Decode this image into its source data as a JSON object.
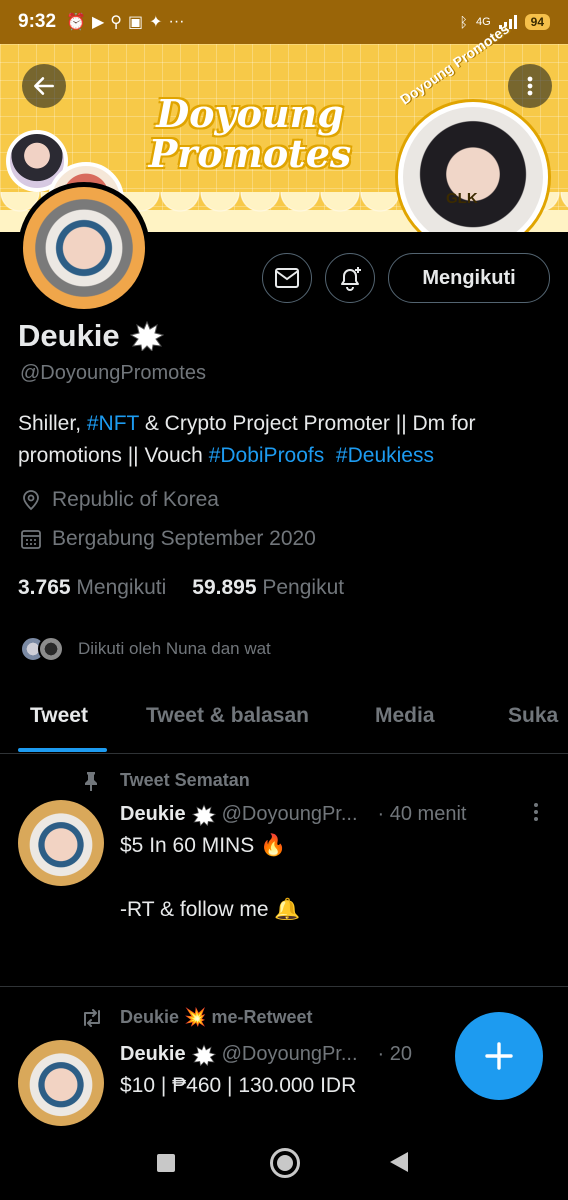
{
  "status_bar": {
    "time": "9:32",
    "network": "4G",
    "battery": "94"
  },
  "banner": {
    "title_line1": "Doyoung",
    "title_line2": "Promotes",
    "circle_text": "Doyoung Promotes",
    "sticker": "GLK",
    "accent_color": "#f7c948"
  },
  "profile": {
    "follow_button": "Mengikuti",
    "name": "Deukie",
    "handle": "@DoyoungPromotes",
    "bio": {
      "part1": "Shiller, ",
      "tag1": "#NFT",
      "part2": " & Crypto Project Promoter || Dm for promotions || Vouch ",
      "tag2": "#DobiProofs",
      "part3": "  ",
      "tag3": "#Deukiess"
    },
    "location": "Republic of Korea",
    "joined": "Bergabung September 2020",
    "following_count": "3.765",
    "following_label": "Mengikuti",
    "followers_count": "59.895",
    "followers_label": "Pengikut",
    "followed_by": "Diikuti oleh Nuna dan wat"
  },
  "tabs": [
    "Tweet",
    "Tweet & balasan",
    "Media",
    "Suka"
  ],
  "tweets": [
    {
      "context": "Tweet Sematan",
      "name": "Deukie",
      "handle": "@DoyoungPr...",
      "time": "· 40 menit",
      "line1": "$5 In 60 MINS 🔥",
      "line2": "-RT & follow me 🔔"
    },
    {
      "context": "Deukie 💥 me-Retweet",
      "name": "Deukie",
      "handle": "@DoyoungPr...",
      "time": "· 20",
      "line1": "$10 | ₱460 | 130.000 IDR"
    }
  ],
  "colors": {
    "link": "#1d9bf0",
    "muted": "#71767b",
    "background": "#000000"
  }
}
